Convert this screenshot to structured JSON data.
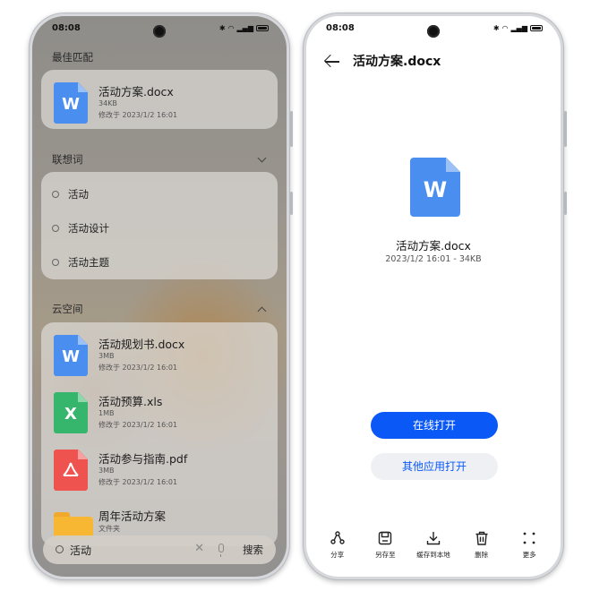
{
  "left": {
    "status": {
      "time": "08:08"
    },
    "best_match": {
      "title": "最佳匹配",
      "file": {
        "name": "活动方案.docx",
        "size": "34KB",
        "modified": "修改于 2023/1/2 16:01",
        "icon": "W"
      }
    },
    "suggestions": {
      "title": "联想词",
      "items": [
        "活动",
        "活动设计",
        "活动主题"
      ]
    },
    "cloud": {
      "title": "云空间",
      "files": [
        {
          "name": "活动规划书.docx",
          "size": "3MB",
          "modified": "修改于 2023/1/2 16:01",
          "icon": "W",
          "color": "#4a8ef0"
        },
        {
          "name": "活动预算.xls",
          "size": "1MB",
          "modified": "修改于 2023/1/2 16:01",
          "icon": "X",
          "color": "#35b66c"
        },
        {
          "name": "活动参与指南.pdf",
          "size": "3MB",
          "modified": "修改于 2023/1/2 16:01",
          "icon": "pdf-icon",
          "color": "#ef5350"
        },
        {
          "name": "周年活动方案",
          "size": "文件夹",
          "icon": "folder-icon",
          "color": "#f7b733"
        }
      ]
    },
    "search": {
      "query": "活动",
      "button": "搜索"
    }
  },
  "right": {
    "status": {
      "time": "08:08"
    },
    "header": {
      "title": "活动方案.docx"
    },
    "doc": {
      "icon": "W",
      "name": "活动方案.docx",
      "info": "2023/1/2 16:01 - 34KB"
    },
    "buttons": {
      "open_online": "在线打开",
      "open_other": "其他应用打开"
    },
    "toolbar": [
      {
        "label": "分享",
        "icon": "share-icon"
      },
      {
        "label": "另存至",
        "icon": "save-as-icon"
      },
      {
        "label": "缓存到本地",
        "icon": "download-icon"
      },
      {
        "label": "删除",
        "icon": "delete-icon"
      },
      {
        "label": "更多",
        "icon": "more-icon"
      }
    ],
    "accent": "#0a59f7"
  }
}
